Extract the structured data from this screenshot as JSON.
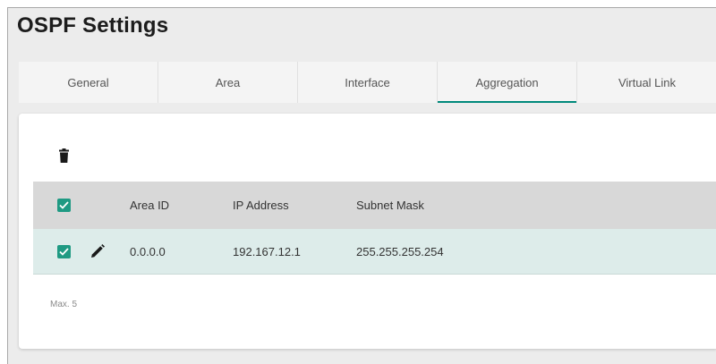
{
  "page": {
    "title": "OSPF Settings"
  },
  "tabs": [
    {
      "label": "General"
    },
    {
      "label": "Area"
    },
    {
      "label": "Interface"
    },
    {
      "label": "Aggregation",
      "active": true
    },
    {
      "label": "Virtual Link"
    }
  ],
  "toolbar": {
    "delete_icon": "trash-icon"
  },
  "table": {
    "headers": {
      "area_id": "Area ID",
      "ip_address": "IP Address",
      "subnet_mask": "Subnet Mask"
    },
    "select_all_checked": true,
    "rows": [
      {
        "checked": true,
        "area_id": "0.0.0.0",
        "ip_address": "192.167.12.1",
        "subnet_mask": "255.255.255.254"
      }
    ]
  },
  "footer": {
    "max_note": "Max. 5"
  },
  "colors": {
    "accent": "#00897b",
    "checkbox": "#1f9a83",
    "row_selected": "#ddecea",
    "header_bg": "#d8d8d8"
  }
}
